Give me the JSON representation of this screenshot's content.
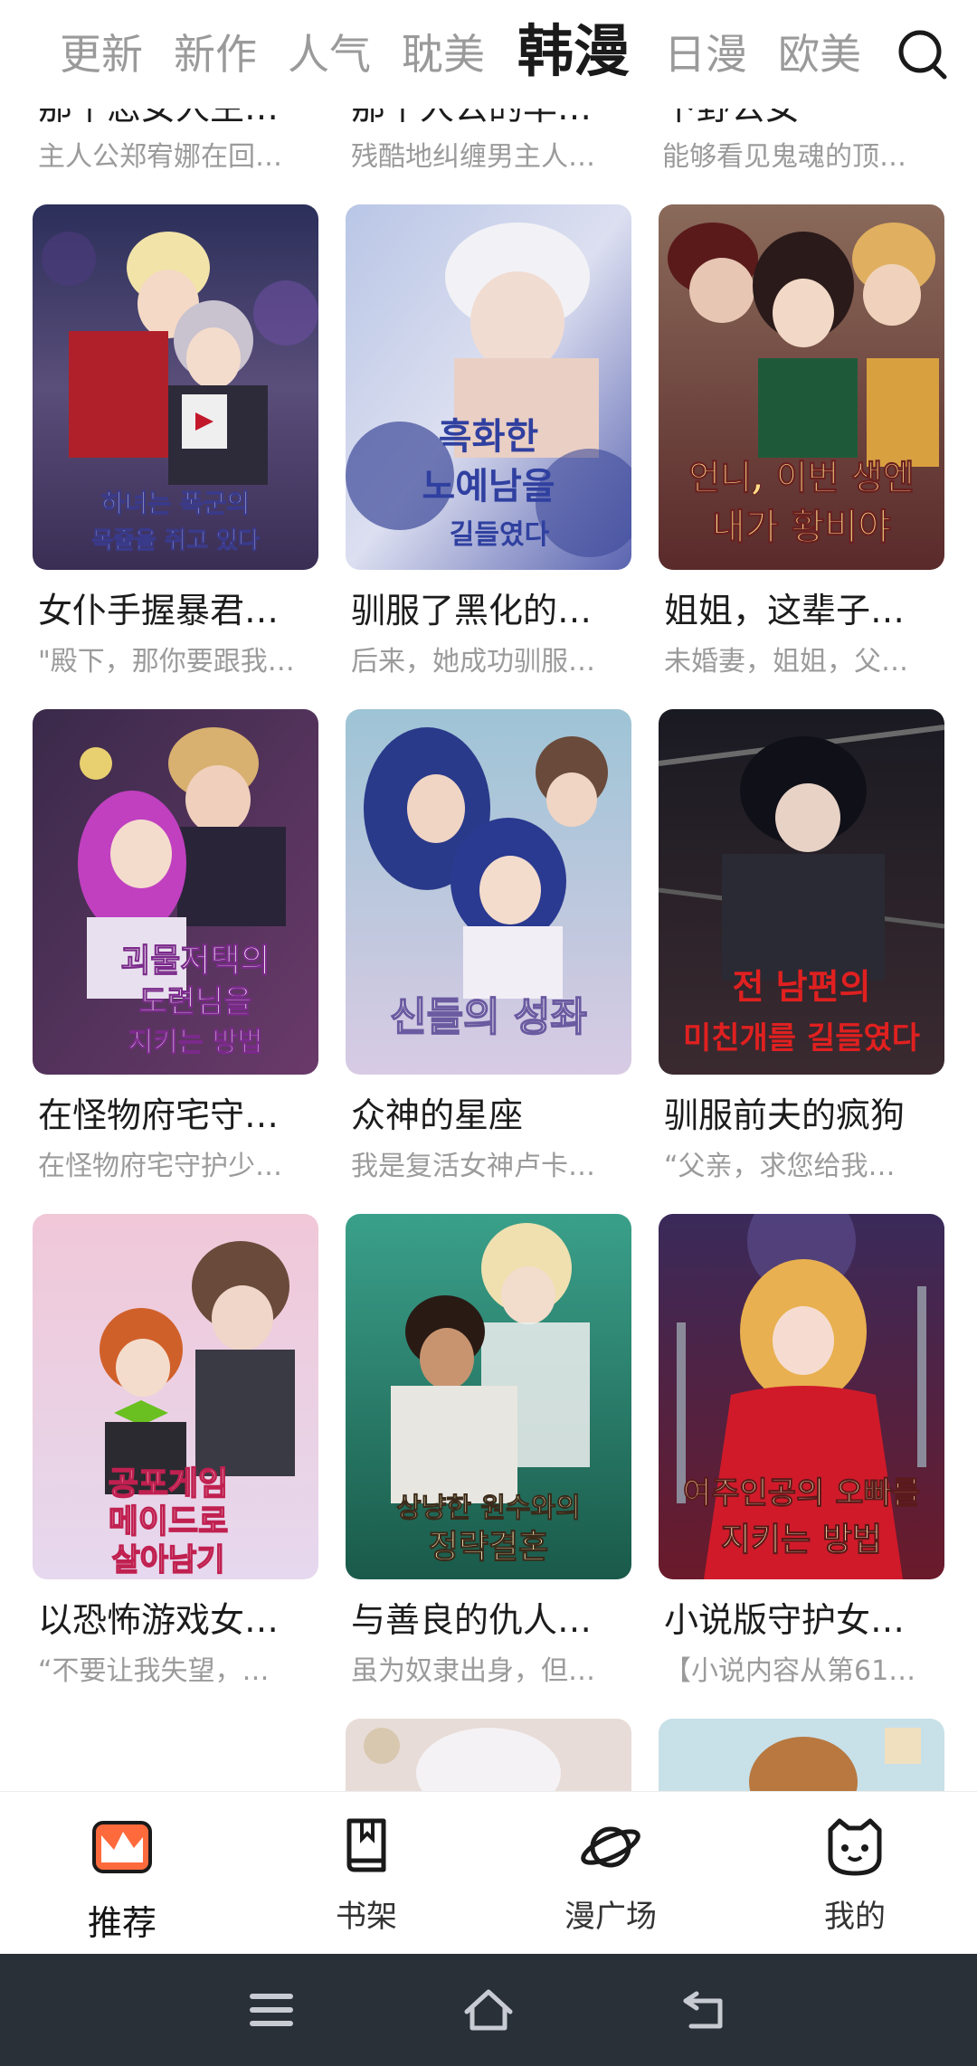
{
  "tabs": [
    {
      "label": "更新"
    },
    {
      "label": "新作"
    },
    {
      "label": "人气"
    },
    {
      "label": "耽美"
    },
    {
      "label": "韩漫"
    },
    {
      "label": "日漫"
    },
    {
      "label": "欧美"
    }
  ],
  "partial_row": [
    {
      "title": "那个恶女人生…",
      "desc": "主人公郑宥娜在回…"
    },
    {
      "title": "那个人公的华…",
      "desc": "残酷地纠缠男主人…"
    },
    {
      "title": "下野公女",
      "desc": "能够看见鬼魂的顶…"
    }
  ],
  "comics": [
    {
      "title": "女仆手握暴君…",
      "desc": "\"殿下，那你要跟我…",
      "cover_text": "하녀는 폭군의 목줄을 쥐고 있다"
    },
    {
      "title": "驯服了黑化的…",
      "desc": "后来，她成功驯服…",
      "cover_text": "흑화한 노예남을 길들였다"
    },
    {
      "title": "姐姐，这辈子…",
      "desc": "未婚妻，姐姐，父…",
      "cover_text": "언니, 이번 생엔 내가 황비야"
    },
    {
      "title": "在怪物府宅守…",
      "desc": "在怪物府宅守护少…",
      "cover_text": "괴물저택의 도련님을 지키는 방법"
    },
    {
      "title": "众神的星座",
      "desc": "我是复活女神卢卡…",
      "cover_text": "신들의 성좌"
    },
    {
      "title": "驯服前夫的疯狗",
      "desc": "“父亲，求您给我…",
      "cover_text": "전 남편의 미친개를 길들였다"
    },
    {
      "title": "以恐怖游戏女…",
      "desc": "“不要让我失望，…",
      "cover_text": "공포게임 메이드로 살아남기"
    },
    {
      "title": "与善良的仇人…",
      "desc": "虽为奴隶出身，但…",
      "cover_text": "상냥한 원수와의 정략결혼"
    },
    {
      "title": "小说版守护女…",
      "desc": "【小说内容从第61…",
      "cover_text": "여주인공의 오빠를 지키는 방법"
    }
  ],
  "bottom_nav": [
    {
      "label": "推荐",
      "icon": "recommend-icon"
    },
    {
      "label": "书架",
      "icon": "bookshelf-icon"
    },
    {
      "label": "漫广场",
      "icon": "planet-icon"
    },
    {
      "label": "我的",
      "icon": "cat-profile-icon"
    }
  ],
  "system_nav": {
    "icons": [
      "menu-icon",
      "home-icon",
      "back-icon"
    ]
  },
  "colors": {
    "active_tab": "#1a1a1a",
    "inactive_tab": "#9a9a9a",
    "accent": "#ff6a3d",
    "system_bar": "#2a3038"
  }
}
